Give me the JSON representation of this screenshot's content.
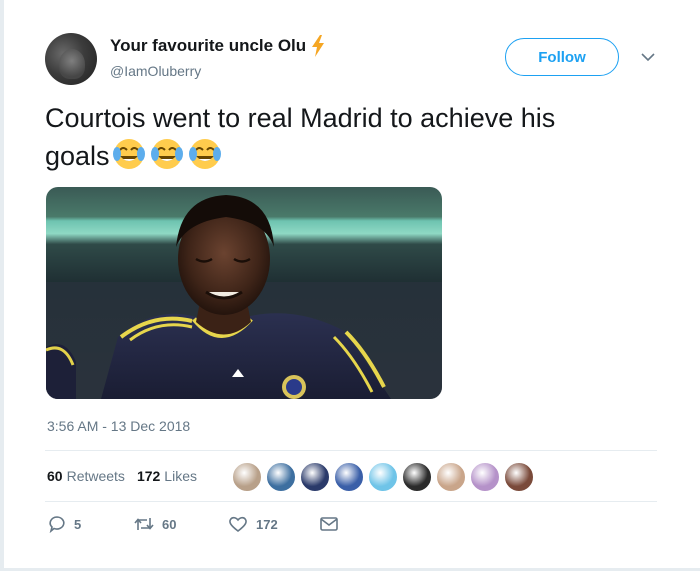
{
  "author": {
    "display_name": "Your favourite uncle Olu",
    "name_emoji": "high-voltage-icon",
    "handle": "@IamOluberry"
  },
  "header": {
    "follow_label": "Follow",
    "more_icon": "chevron-down-icon"
  },
  "tweet": {
    "text_line1": "Courtois went to real Madrid to achieve his",
    "text_line2": "goals",
    "emojis": [
      "face-with-tears-of-joy-icon",
      "face-with-tears-of-joy-icon",
      "face-with-tears-of-joy-icon"
    ],
    "media_alt": "football-player-photo"
  },
  "meta": {
    "timestamp": "3:56 AM - 13 Dec 2018"
  },
  "stats": {
    "retweets_count": "60",
    "retweets_label": "Retweets",
    "likes_count": "172",
    "likes_label": "Likes",
    "likers": [
      {
        "color": "#b8a089"
      },
      {
        "color": "#3d6fa0"
      },
      {
        "color": "#2a3a6a"
      },
      {
        "color": "#3a5fa8"
      },
      {
        "color": "#6fc4e8"
      },
      {
        "color": "#2b2b2b"
      },
      {
        "color": "#c9a58a"
      },
      {
        "color": "#b592c9"
      },
      {
        "color": "#7a4a3a"
      }
    ]
  },
  "actions": {
    "reply_count": "5",
    "retweet_count": "60",
    "like_count": "172"
  },
  "colors": {
    "accent": "#1da1f2",
    "text": "#14171a",
    "secondary": "#657786",
    "divider": "#e6ecf0",
    "bolt": "#f5a623"
  }
}
